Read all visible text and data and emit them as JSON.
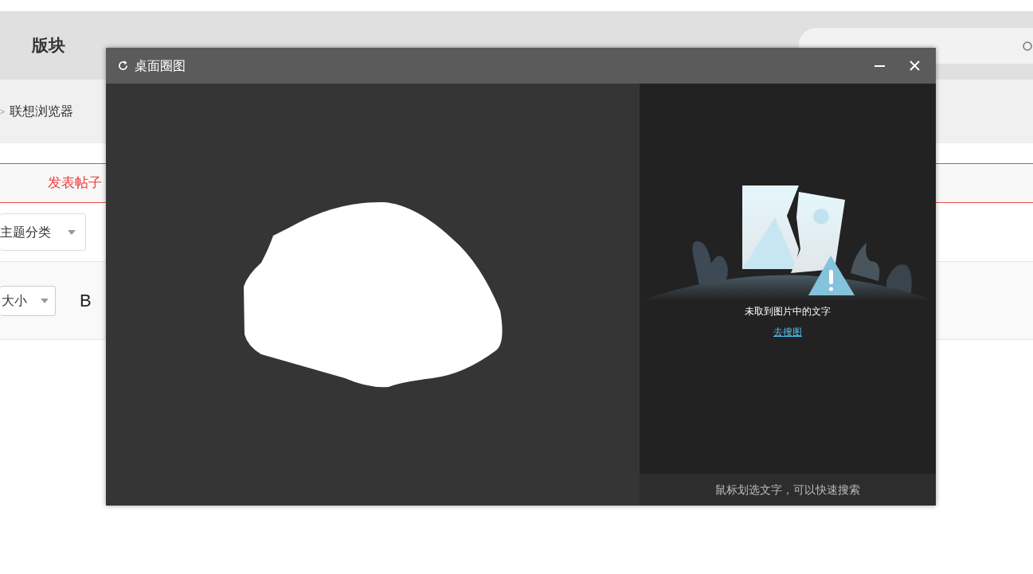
{
  "nav": {
    "items": [
      {
        "label": "版块"
      }
    ]
  },
  "breadcrumb": {
    "separator": ">",
    "current": "联想浏览器"
  },
  "post_tab": {
    "label": "发表帖子"
  },
  "category_select": {
    "value": "主题分类"
  },
  "editor_toolbar": {
    "font_size": "大小",
    "bold": "B"
  },
  "dialog": {
    "title": "桌面圈图",
    "message": "未取到图片中的文字",
    "link": "去搜图",
    "hint": "鼠标划选文字，可以快速搜索"
  }
}
